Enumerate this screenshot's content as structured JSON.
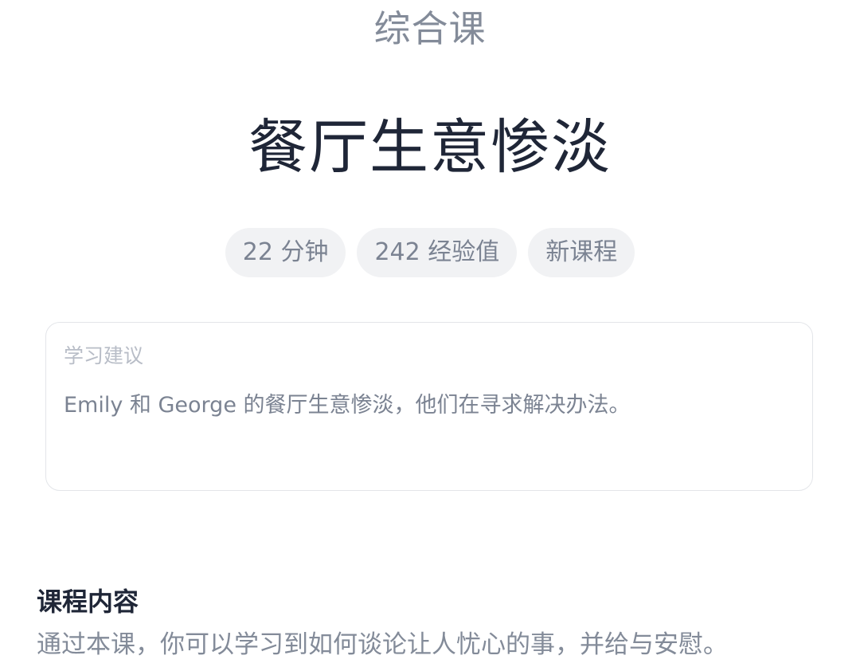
{
  "header": {
    "course_type": "综合课",
    "lesson_title": "餐厅生意惨淡"
  },
  "badges": [
    {
      "label": "22 分钟"
    },
    {
      "label": "242 经验值"
    },
    {
      "label": "新课程"
    }
  ],
  "suggestion": {
    "label": "学习建议",
    "text": "Emily 和 George 的餐厅生意惨淡，他们在寻求解决办法。"
  },
  "content": {
    "heading": "课程内容",
    "description": "通过本课，你可以学习到如何谈论让人忧心的事，并给与安慰。"
  },
  "colors": {
    "title": "#1f2637",
    "muted": "#838b99",
    "badge_bg": "#f1f2f4",
    "card_border": "#e3e5e9"
  }
}
